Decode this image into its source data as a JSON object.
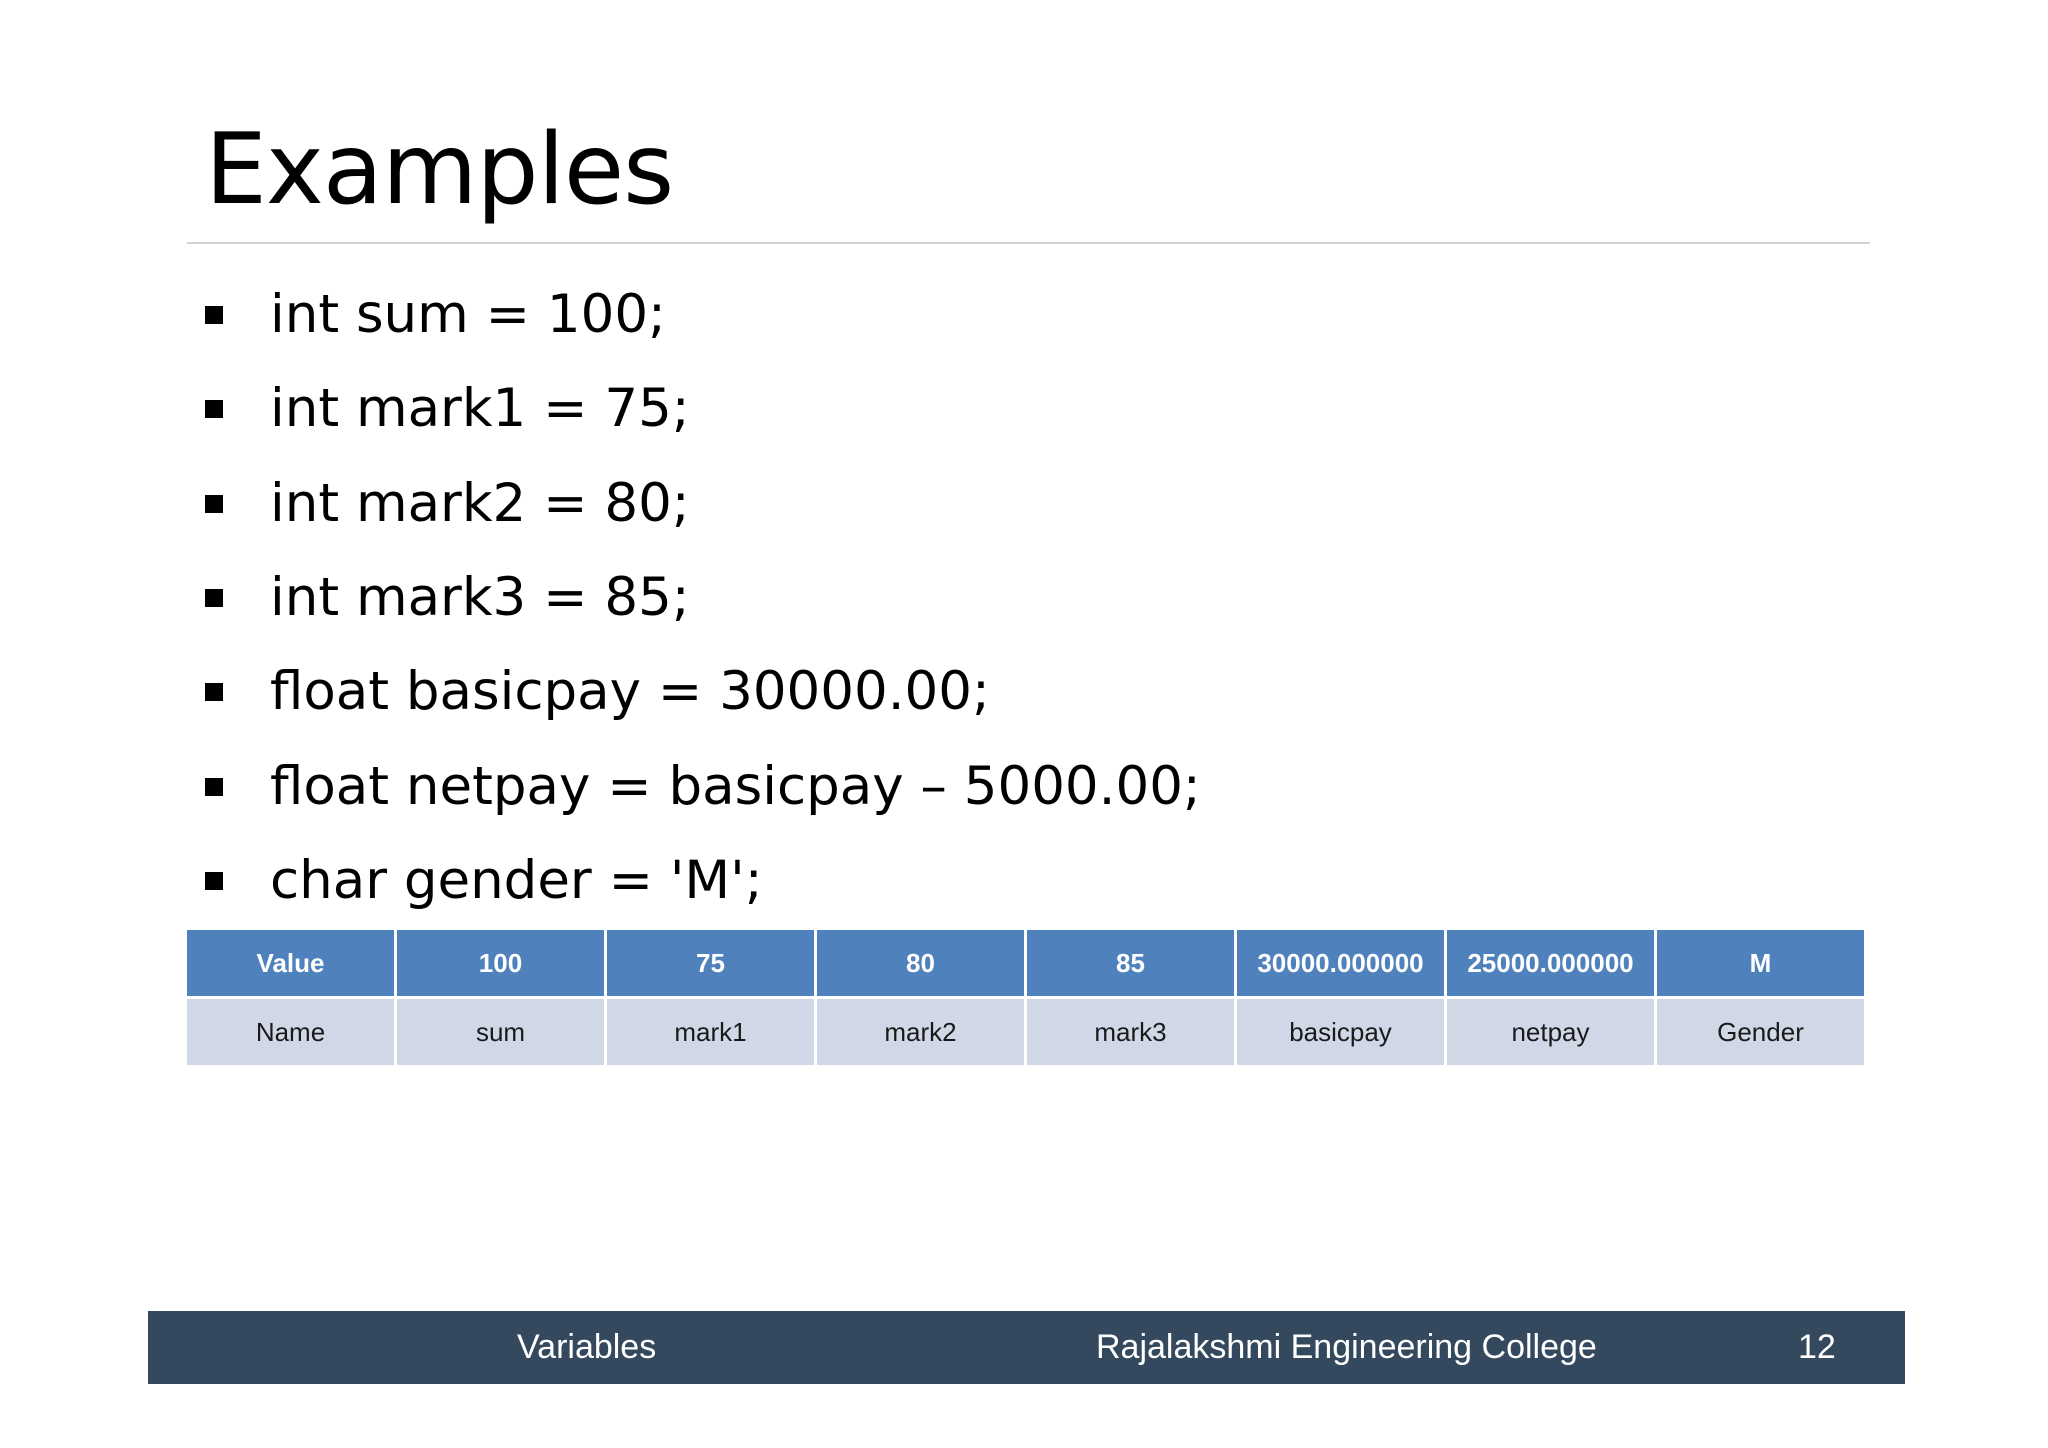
{
  "slide": {
    "title": "Examples",
    "bullets": [
      "int sum = 100;",
      "int mark1 = 75;",
      "int mark2 = 80;",
      "int mark3 = 85;",
      "float basicpay = 30000.00;",
      "float netpay = basicpay – 5000.00;",
      "char gender = 'M';"
    ],
    "table": {
      "value_row": [
        "Value",
        "100",
        "75",
        "80",
        "85",
        "30000.000000",
        "25000.000000",
        "M"
      ],
      "name_row": [
        "Name",
        "sum",
        "mark1",
        "mark2",
        "mark3",
        "basicpay",
        "netpay",
        "Gender"
      ]
    },
    "footer": {
      "topic": "Variables",
      "college": "Rajalakshmi Engineering College",
      "page_number": "12"
    },
    "colors": {
      "header_row": "#4f81bd",
      "name_row": "#d0d8e8",
      "footer_bar": "#34495e",
      "title_rule": "#d4d4d4"
    }
  }
}
